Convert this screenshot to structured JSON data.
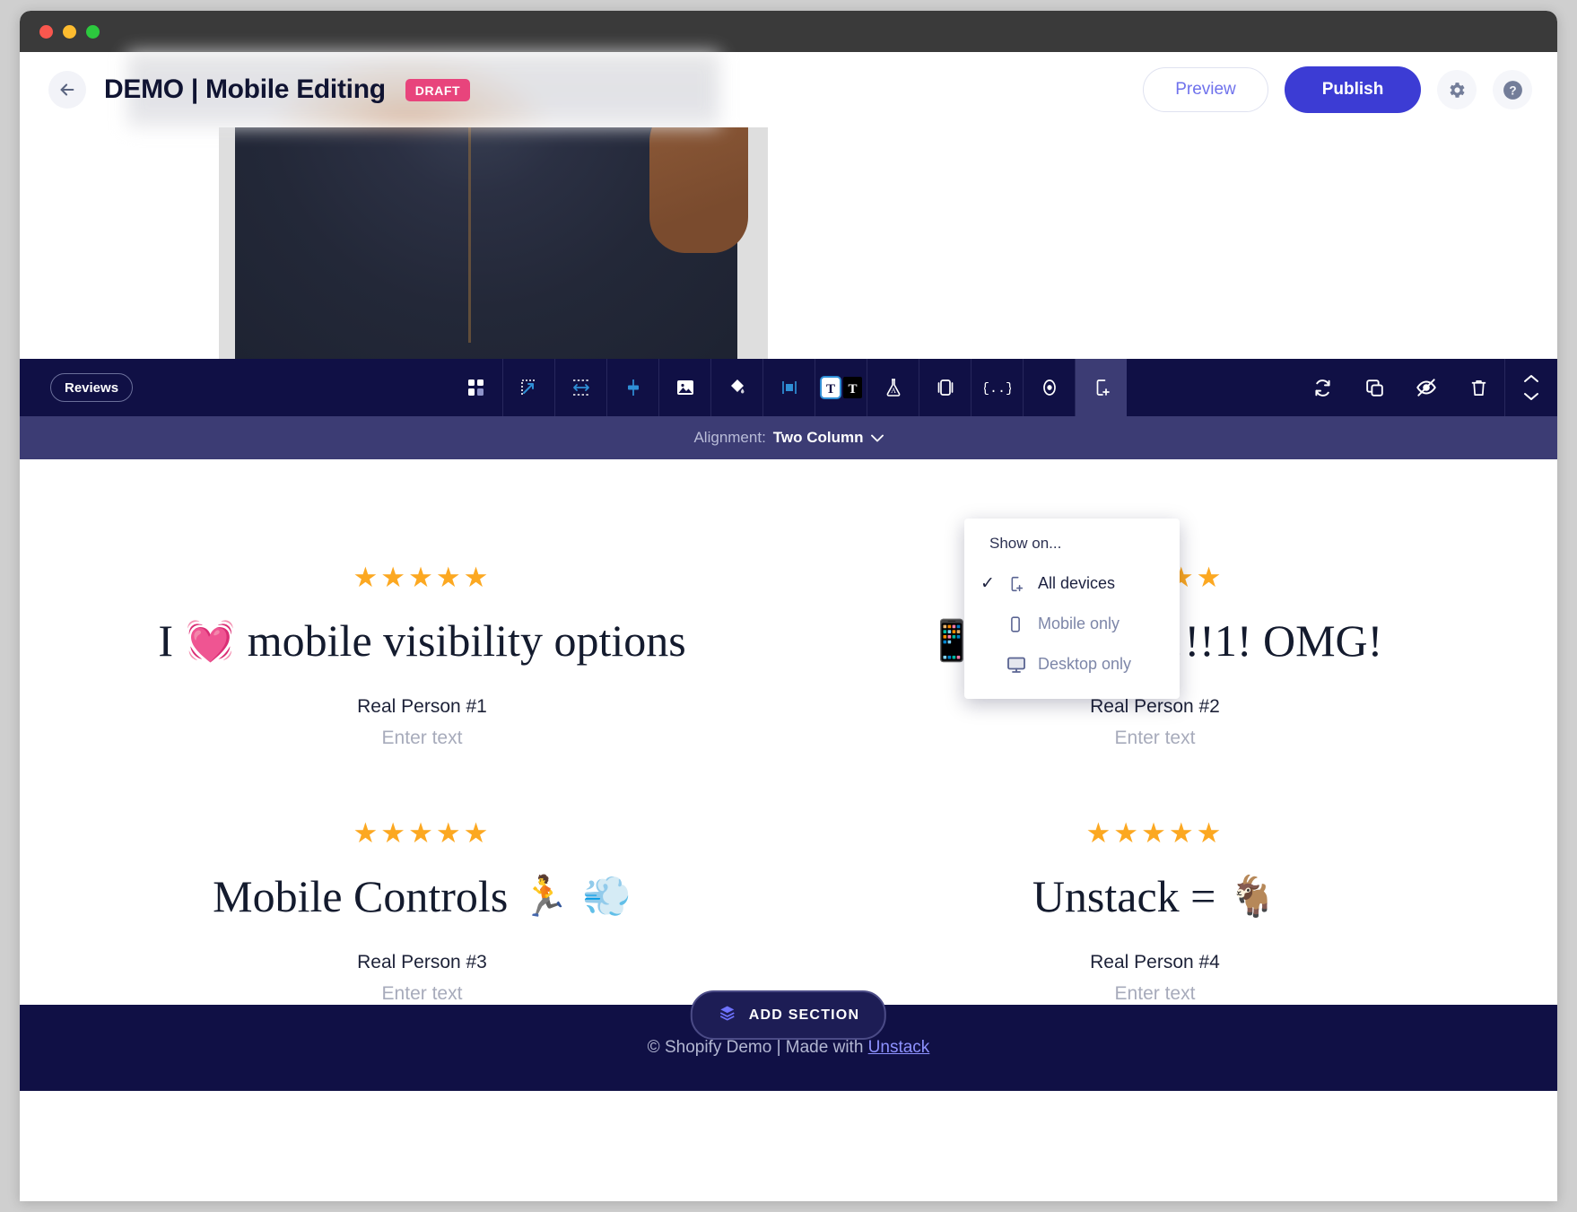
{
  "window": {
    "traffic_lights": [
      "close",
      "minimize",
      "zoom"
    ]
  },
  "header": {
    "back_icon": "arrow-left-icon",
    "title": "DEMO | Mobile Editing",
    "status_badge": "DRAFT",
    "preview_label": "Preview",
    "publish_label": "Publish",
    "settings_icon": "gear-icon",
    "help_icon": "help-circle-icon",
    "accent_color": "#3c3cd4",
    "badge_color": "#e8447c"
  },
  "toolbar": {
    "section_label": "Reviews",
    "background": "#101045",
    "active_background": "#3c3c74",
    "tools": [
      {
        "name": "grid-layout-icon",
        "label": "Layout"
      },
      {
        "name": "resize-icon",
        "label": "Resize"
      },
      {
        "name": "spacing-icon",
        "label": "Spacing"
      },
      {
        "name": "align-icon",
        "label": "Align"
      },
      {
        "name": "image-icon",
        "label": "Image"
      },
      {
        "name": "fill-color-icon",
        "label": "Fill"
      },
      {
        "name": "background-icon",
        "label": "Background"
      },
      {
        "name": "text-style-icon",
        "label": "Text style"
      },
      {
        "name": "experiment-flask-icon",
        "label": "A/B test"
      },
      {
        "name": "columns-icon",
        "label": "Columns"
      },
      {
        "name": "code-braces-icon",
        "label": "Embed code"
      },
      {
        "name": "target-icon",
        "label": "Personalize"
      },
      {
        "name": "device-visibility-icon",
        "label": "Show on..."
      }
    ],
    "actions": [
      {
        "name": "refresh-icon",
        "label": "Reset"
      },
      {
        "name": "duplicate-icon",
        "label": "Duplicate"
      },
      {
        "name": "hide-eye-icon",
        "label": "Hide"
      },
      {
        "name": "trash-icon",
        "label": "Delete"
      }
    ],
    "reorder": {
      "up_icon": "chevron-up-icon",
      "down_icon": "chevron-down-icon"
    }
  },
  "subbar": {
    "alignment_label": "Alignment:",
    "alignment_value": "Two Column",
    "chevron_icon": "chevron-down-icon",
    "background": "#3c3c74"
  },
  "dropdown": {
    "title": "Show on...",
    "items": [
      {
        "label": "All devices",
        "icon": "device-all-icon",
        "selected": true,
        "check": "✓"
      },
      {
        "label": "Mobile only",
        "icon": "mobile-icon",
        "selected": false,
        "check": ""
      },
      {
        "label": "Desktop only",
        "icon": "desktop-icon",
        "selected": false,
        "check": ""
      }
    ]
  },
  "reviews": {
    "star_glyph": "★★★★★",
    "star_color": "#fca821",
    "placeholder": "Enter text",
    "items": [
      {
        "rating": 5,
        "emoji_lead": "",
        "title_pre": "I",
        "emoji": "💓",
        "title_post": "mobile visibility options",
        "author": "Real Person #1",
        "body_placeholder": "Enter text"
      },
      {
        "rating": 5,
        "emoji_lead": "📱",
        "title_pre": "",
        "emoji": "",
        "title_post": "VIZ ROX!!!1! OMG!",
        "author": "Real Person #2",
        "body_placeholder": "Enter text"
      },
      {
        "rating": 5,
        "emoji_lead": "",
        "title_pre": "Mobile Controls",
        "emoji": "🏃",
        "title_post": "💨",
        "author": "Real Person #3",
        "body_placeholder": "Enter text"
      },
      {
        "rating": 5,
        "emoji_lead": "",
        "title_pre": "Unstack =",
        "emoji": "🐐",
        "title_post": "",
        "author": "Real Person #4",
        "body_placeholder": "Enter text"
      }
    ]
  },
  "footer": {
    "add_section_label": "ADD SECTION",
    "add_section_icon": "layers-icon",
    "copyright_pre": "© Shopify ",
    "copyright_mid": "Demo | Made with ",
    "link_label": "Unstack"
  }
}
